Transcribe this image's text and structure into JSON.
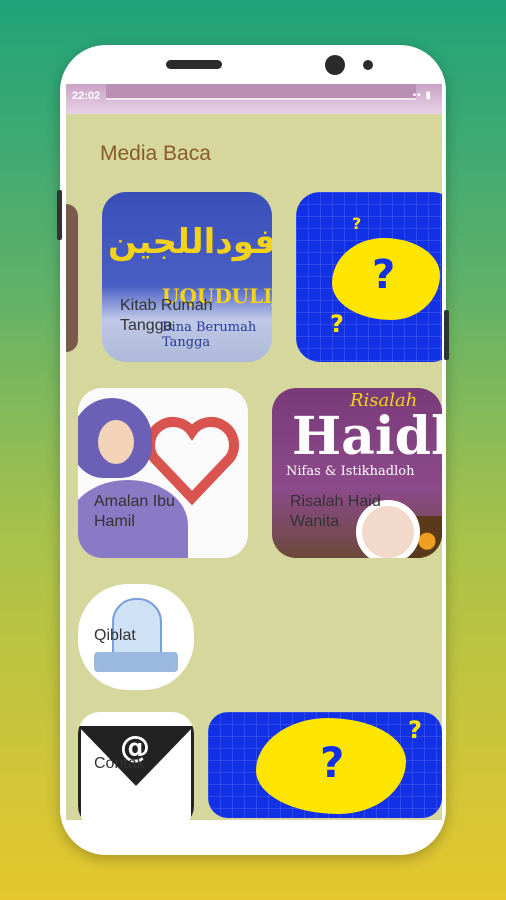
{
  "status_bar": {
    "time": "22:02",
    "icons": "▪▪ ▮"
  },
  "section_title": "Media Baca",
  "tiles": [
    {
      "label": "Kitab Rumah Tangga",
      "art_arabic": "فوداللجين",
      "art_latin": "UQUDULIJAIN",
      "art_sub": "Bina Berumah Tangga"
    },
    {
      "label": "",
      "art_glyph": "?"
    },
    {
      "label": "Amalan Ibu Hamil"
    },
    {
      "label": "Risalah Haid Wanita",
      "art_title": "Risalah",
      "art_big": "Haidl",
      "art_sub": "Nifas & Istikhadloh"
    },
    {
      "label": "Qiblat"
    },
    {
      "label": "Contak",
      "art_glyph": "@"
    },
    {
      "label": "",
      "art_glyph": "?"
    }
  ],
  "colors": {
    "screen_bg": "#d5d79c",
    "title": "#8a5a2a",
    "unknown_bg": "#1230e6",
    "blob": "#ffe600"
  }
}
